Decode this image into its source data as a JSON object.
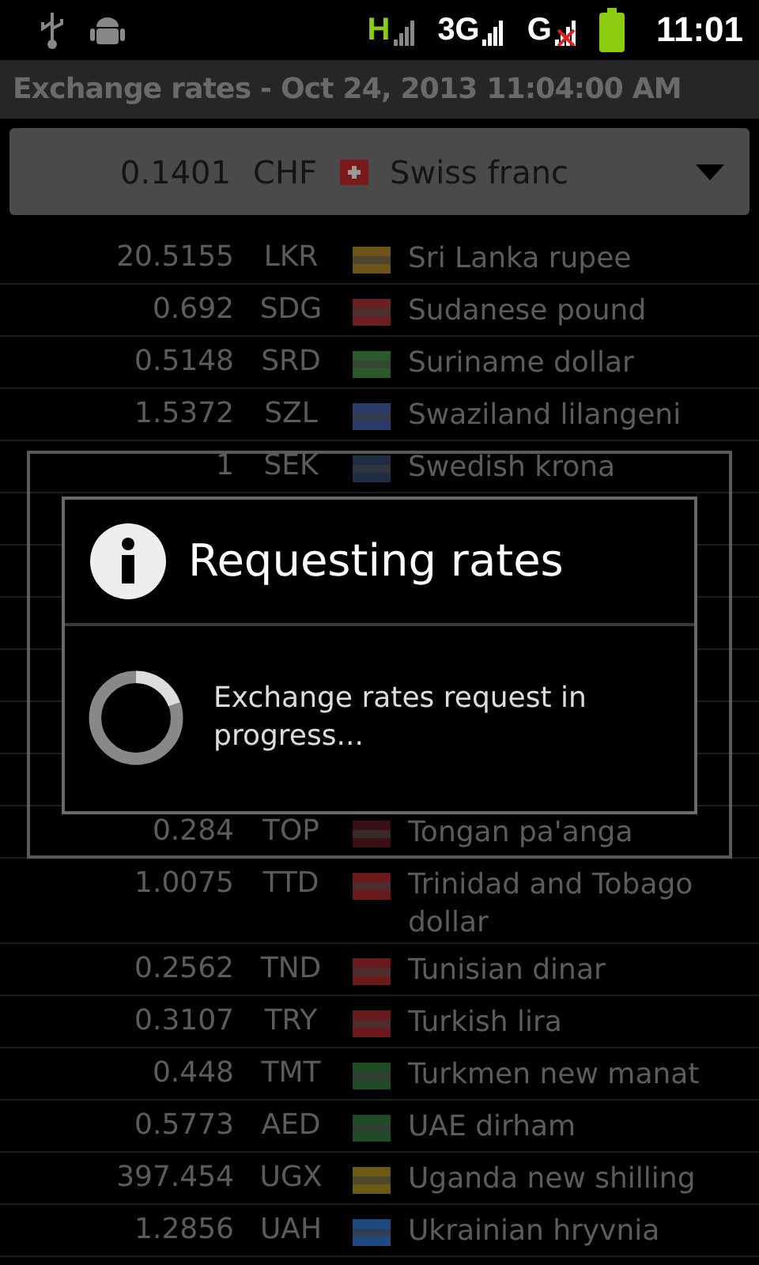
{
  "status_bar": {
    "network_labels": [
      "H",
      "3G",
      "G"
    ],
    "time": "11:01"
  },
  "title_bar": {
    "title": "Exchange rates - Oct 24, 2013 11:04:00 AM"
  },
  "currency_spinner": {
    "rate": "0.1401",
    "code": "CHF",
    "name": "Swiss franc",
    "color": "#7a1a1a"
  },
  "rates_above_dialog": [
    {
      "rate": "20.5155",
      "code": "LKR",
      "name": "Sri Lanka rupee",
      "color": "#6e5418"
    },
    {
      "rate": "0.692",
      "code": "SDG",
      "name": "Sudanese pound",
      "color": "#6a2020"
    },
    {
      "rate": "0.5148",
      "code": "SRD",
      "name": "Suriname dollar",
      "color": "#2a5a2a"
    },
    {
      "rate": "1.5372",
      "code": "SZL",
      "name": "Swaziland lilangeni",
      "color": "#2a3c6a"
    },
    {
      "rate": "1",
      "code": "SEK",
      "name": "Swedish krona",
      "color": "#1e2c44"
    }
  ],
  "rates_below_dialog": [
    {
      "rate": "0.284",
      "code": "TOP",
      "name": "Tongan pa'anga",
      "color": "#3a1014"
    },
    {
      "rate": "1.0075",
      "code": "TTD",
      "name": "Trinidad and Tobago dollar",
      "color": "#6a1a1a"
    },
    {
      "rate": "0.2562",
      "code": "TND",
      "name": "Tunisian dinar",
      "color": "#6a1a1a"
    },
    {
      "rate": "0.3107",
      "code": "TRY",
      "name": "Turkish lira",
      "color": "#6a1a1a"
    },
    {
      "rate": "0.448",
      "code": "TMT",
      "name": "Turkmen new manat",
      "color": "#1e4a26"
    },
    {
      "rate": "0.5773",
      "code": "AED",
      "name": "UAE dirham",
      "color": "#1e4a26"
    },
    {
      "rate": "397.454",
      "code": "UGX",
      "name": "Uganda new shilling",
      "color": "#6a5a14"
    },
    {
      "rate": "1.2856",
      "code": "UAH",
      "name": "Ukrainian hryvnia",
      "color": "#1e4a80"
    }
  ],
  "dialog": {
    "title": "Requesting rates",
    "message": "Exchange rates request in progress..."
  }
}
